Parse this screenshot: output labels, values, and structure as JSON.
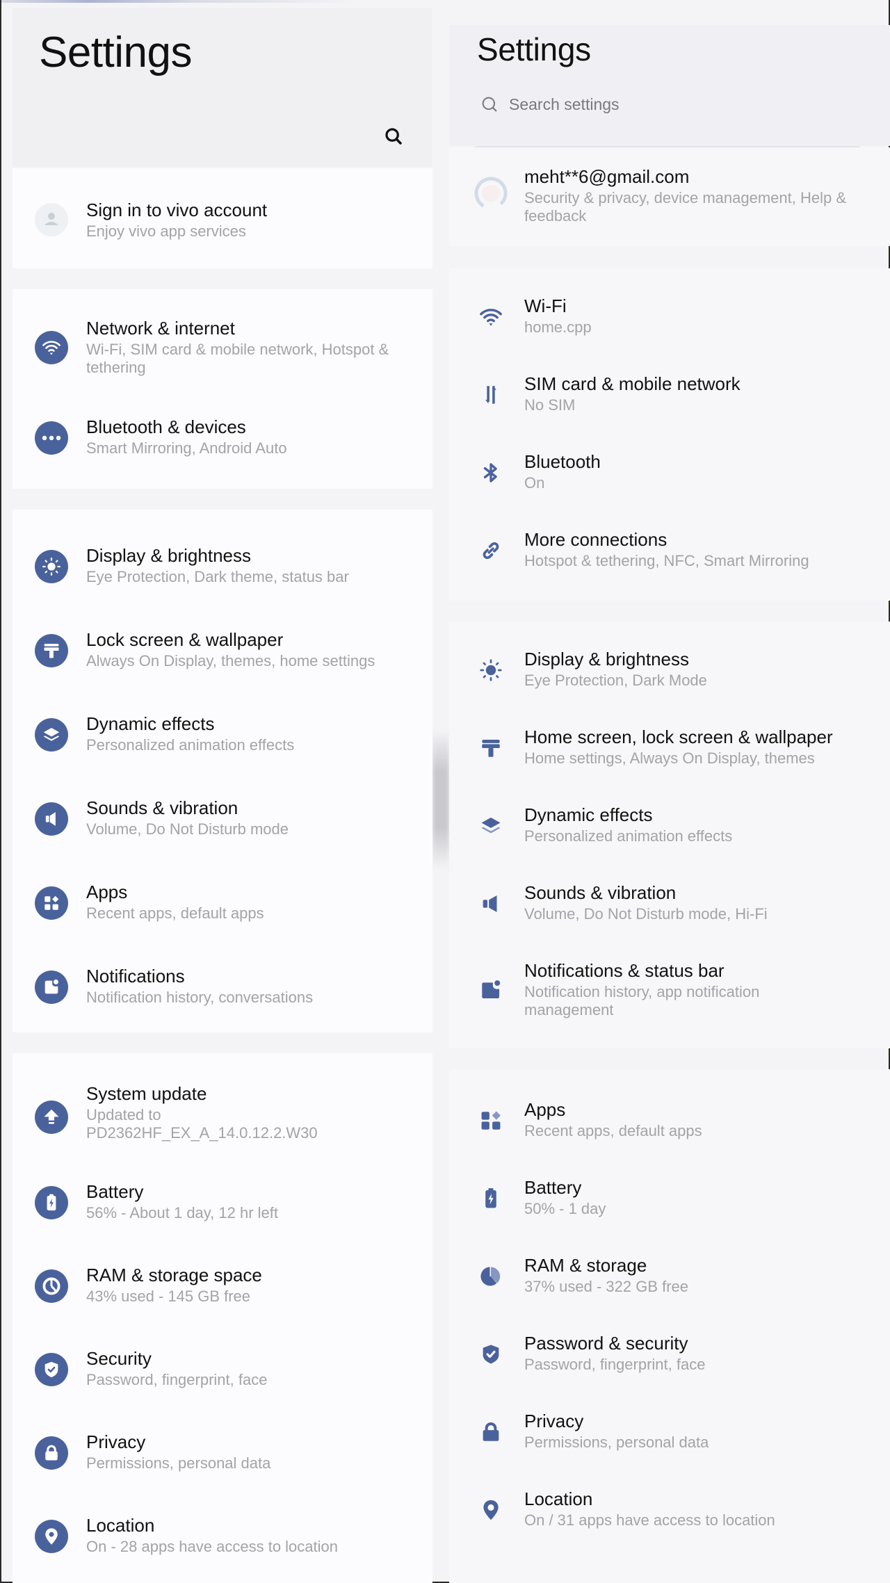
{
  "colors": {
    "accent": "#4a629c",
    "accent_light": "#8797c4",
    "title_text": "#111111",
    "subtitle_text": "#a3a3a8",
    "card_bg": "#fcfbfd",
    "header_bg": "#f0f0f3"
  },
  "left": {
    "title": "Settings",
    "search_icon": "search-icon",
    "account": {
      "label": "Sign in to vivo account",
      "sub": "Enjoy vivo app services",
      "icon": "avatar-placeholder-icon"
    },
    "groups": [
      {
        "items": [
          {
            "label": "Network & internet",
            "sub": "Wi-Fi, SIM card & mobile network, Hotspot & tethering",
            "icon": "wifi-icon"
          },
          {
            "label": "Bluetooth & devices",
            "sub": "Smart Mirroring, Android Auto",
            "icon": "more-dots-icon"
          }
        ]
      },
      {
        "items": [
          {
            "label": "Display & brightness",
            "sub": "Eye Protection, Dark theme, status bar",
            "icon": "sun-icon"
          },
          {
            "label": "Lock screen & wallpaper",
            "sub": "Always On Display, themes, home settings",
            "icon": "paint-roller-icon"
          },
          {
            "label": "Dynamic effects",
            "sub": "Personalized animation effects",
            "icon": "layers-icon"
          },
          {
            "label": "Sounds & vibration",
            "sub": "Volume, Do Not Disturb mode",
            "icon": "speaker-icon"
          },
          {
            "label": "Apps",
            "sub": "Recent apps, default apps",
            "icon": "apps-grid-icon"
          },
          {
            "label": "Notifications",
            "sub": "Notification history, conversations",
            "icon": "notification-icon"
          }
        ]
      },
      {
        "items": [
          {
            "label": "System update",
            "sub": "Updated to PD2362HF_EX_A_14.0.12.2.W30",
            "icon": "update-arrow-icon"
          },
          {
            "label": "Battery",
            "sub": "56% - About 1 day, 12 hr left",
            "icon": "battery-icon"
          },
          {
            "label": "RAM & storage space",
            "sub": "43% used - 145 GB free",
            "icon": "pie-chart-icon"
          },
          {
            "label": "Security",
            "sub": "Password, fingerprint, face",
            "icon": "shield-check-icon"
          },
          {
            "label": "Privacy",
            "sub": "Permissions, personal data",
            "icon": "lock-icon"
          },
          {
            "label": "Location",
            "sub": "On - 28 apps have access to location",
            "icon": "location-pin-icon"
          }
        ]
      }
    ]
  },
  "right": {
    "title": "Settings",
    "search_placeholder": "Search settings",
    "search_value": "",
    "account": {
      "label": "meht**6@gmail.com",
      "sub": "Security & privacy, device management, Help & feedback",
      "icon": "account-avatar-icon"
    },
    "groups": [
      {
        "items": [
          {
            "label": "Wi-Fi",
            "sub": "home.cpp",
            "icon": "wifi-icon"
          },
          {
            "label": "SIM card & mobile network",
            "sub": "No SIM",
            "icon": "data-arrows-icon"
          },
          {
            "label": "Bluetooth",
            "sub": "On",
            "icon": "bluetooth-icon"
          },
          {
            "label": "More connections",
            "sub": "Hotspot & tethering, NFC, Smart Mirroring",
            "icon": "link-icon"
          }
        ]
      },
      {
        "items": [
          {
            "label": "Display & brightness",
            "sub": "Eye Protection, Dark Mode",
            "icon": "sun-icon"
          },
          {
            "label": "Home screen, lock screen & wallpaper",
            "sub": "Home settings, Always On Display, themes",
            "icon": "paint-roller-icon"
          },
          {
            "label": "Dynamic effects",
            "sub": "Personalized animation effects",
            "icon": "layers-icon"
          },
          {
            "label": "Sounds & vibration",
            "sub": "Volume, Do Not Disturb mode, Hi-Fi",
            "icon": "speaker-icon"
          },
          {
            "label": "Notifications & status bar",
            "sub": "Notification history, app notification management",
            "icon": "notification-icon"
          }
        ]
      },
      {
        "items": [
          {
            "label": "Apps",
            "sub": "Recent apps, default apps",
            "icon": "apps-grid-icon"
          },
          {
            "label": "Battery",
            "sub": "50% - 1 day",
            "icon": "battery-icon"
          },
          {
            "label": "RAM & storage",
            "sub": "37% used - 322 GB free",
            "icon": "pie-chart-icon"
          },
          {
            "label": "Password & security",
            "sub": "Password, fingerprint, face",
            "icon": "shield-check-icon"
          },
          {
            "label": "Privacy",
            "sub": "Permissions, personal data",
            "icon": "lock-icon"
          },
          {
            "label": "Location",
            "sub": "On / 31 apps have access to location",
            "icon": "location-pin-icon"
          }
        ]
      }
    ]
  }
}
